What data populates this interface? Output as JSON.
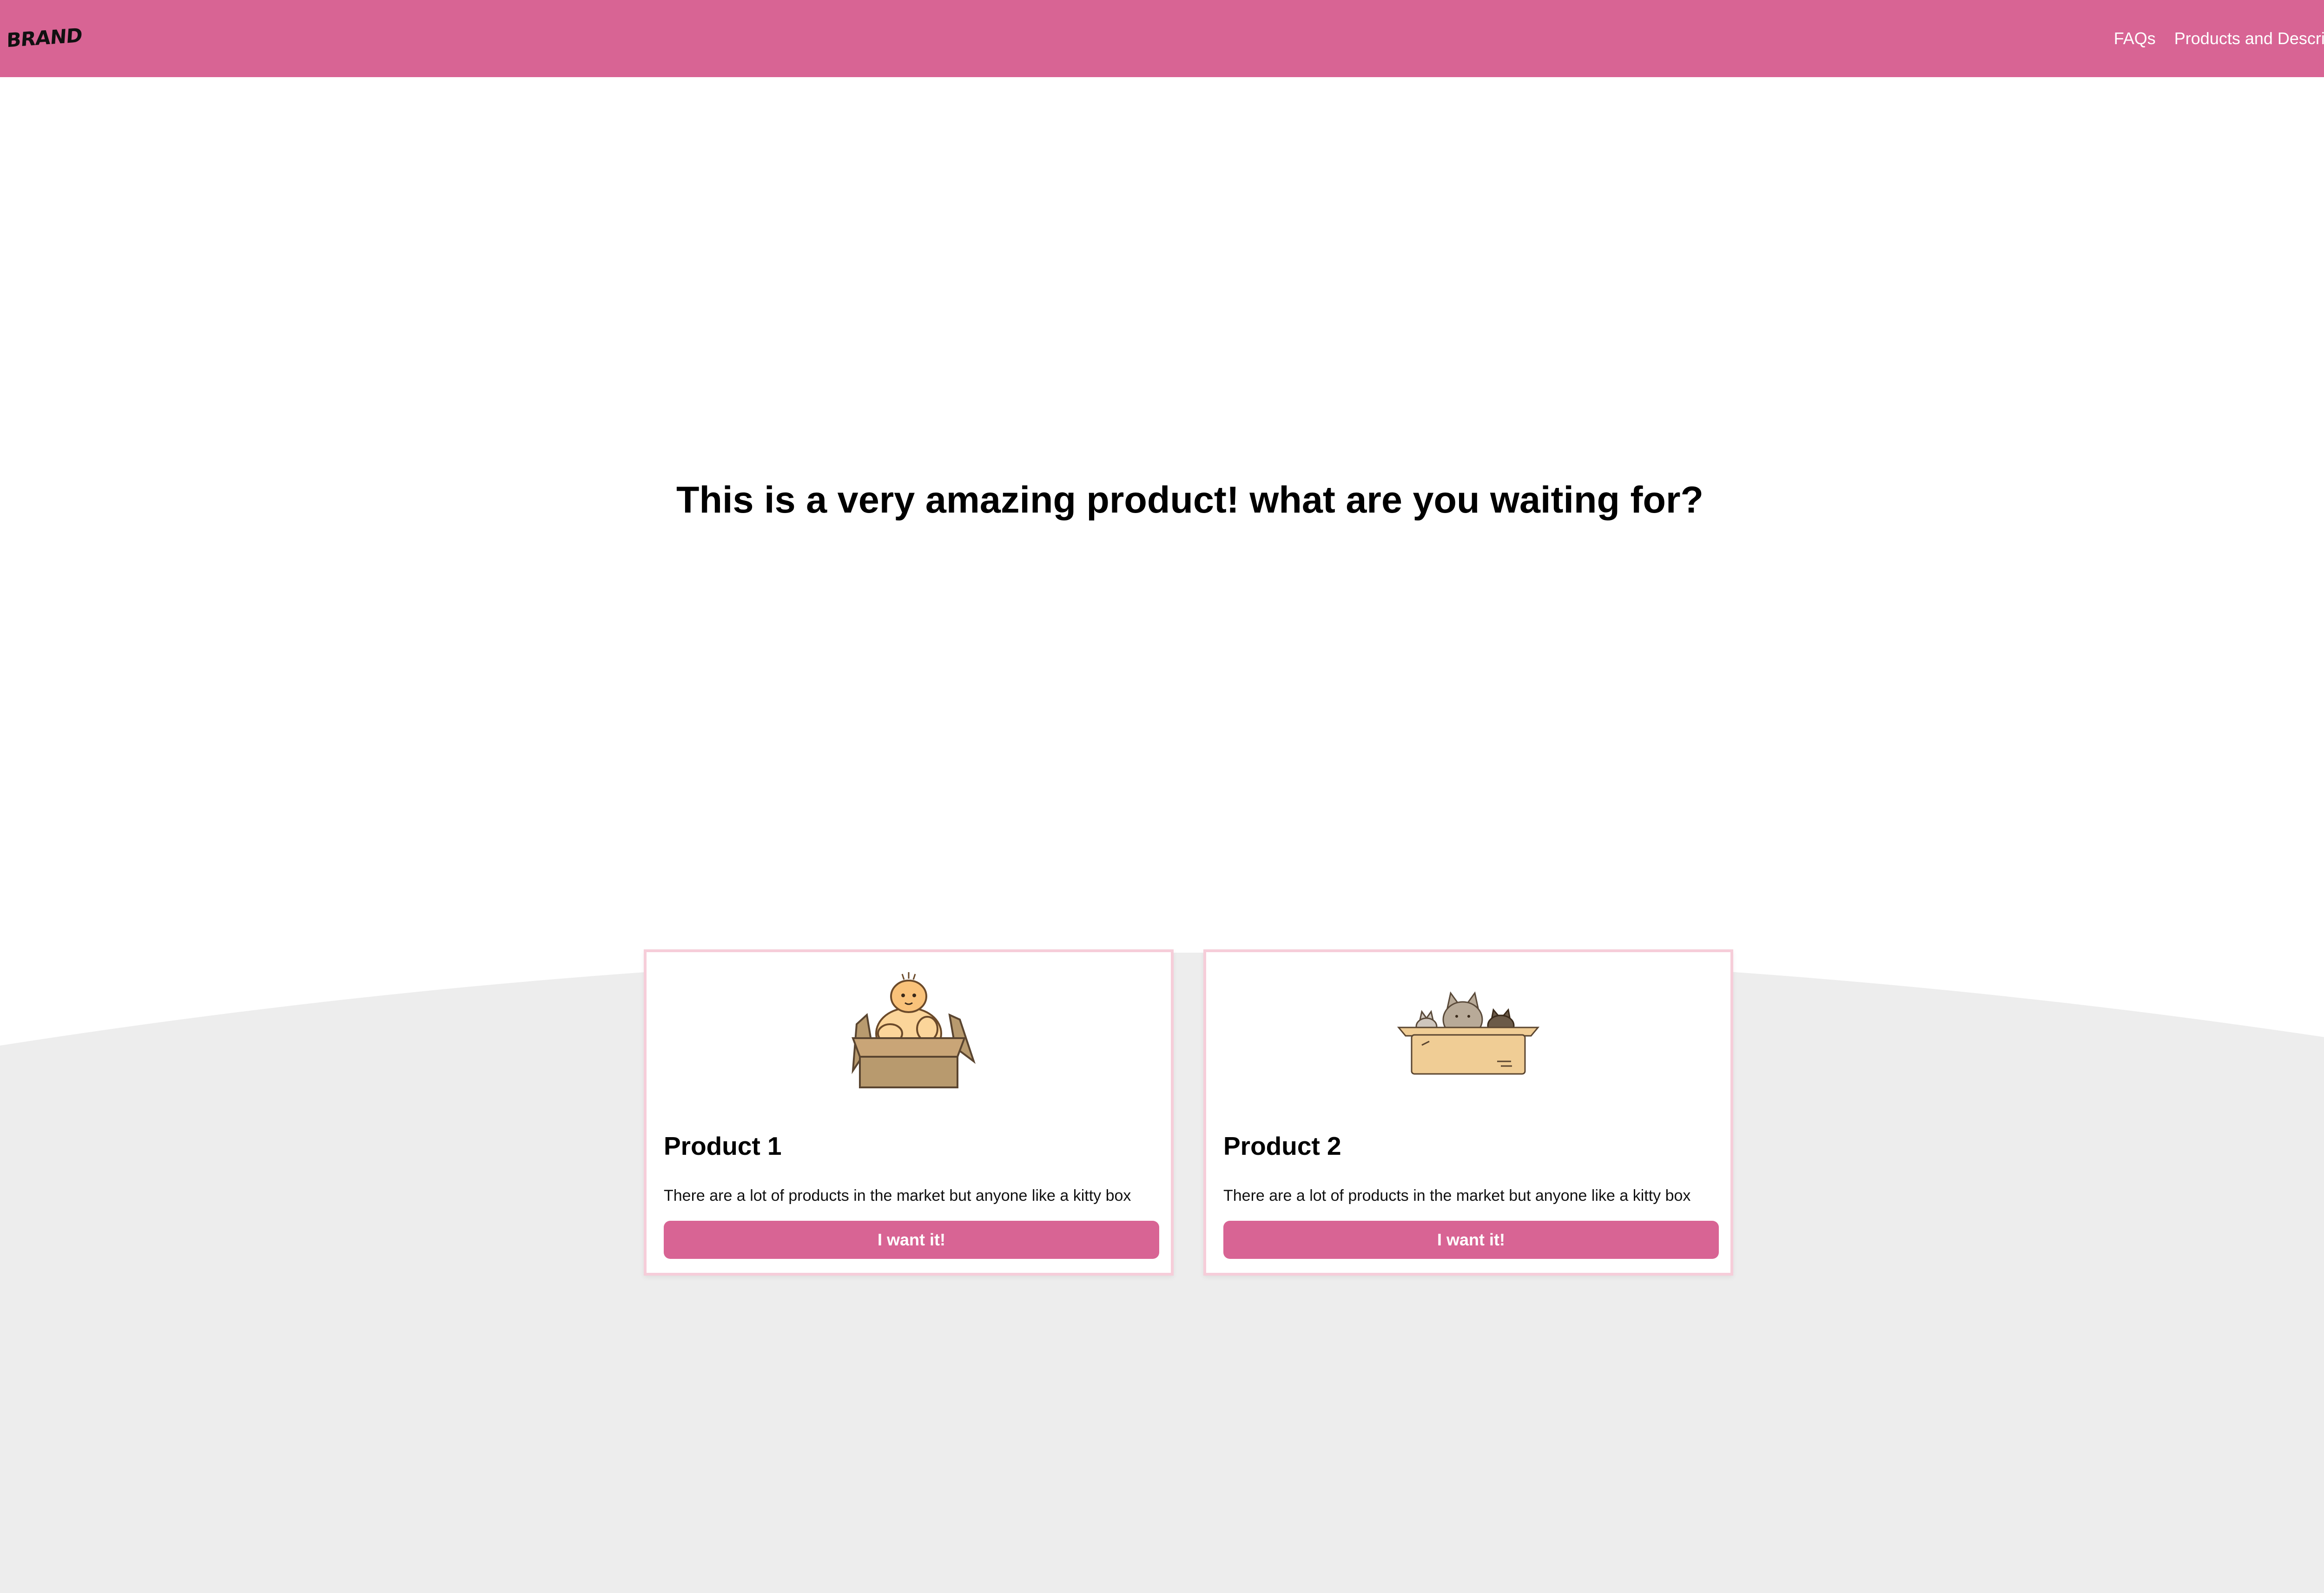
{
  "header": {
    "brand": "BRAND",
    "nav": [
      {
        "label": "FAQs"
      },
      {
        "label": "Products and Description"
      }
    ]
  },
  "hero": {
    "title": "This is a very amazing product! what are you waiting for?"
  },
  "products": [
    {
      "title": "Product 1",
      "description": "There are a lot of products in the market but anyone like a kitty box",
      "button_label": "I want it!",
      "image_icon": "cat-in-box-icon"
    },
    {
      "title": "Product 2",
      "description": "There are a lot of products in the market but anyone like a kitty box",
      "button_label": "I want it!",
      "image_icon": "cats-in-box-icon"
    }
  ],
  "colors": {
    "brand_pink": "#d86494",
    "card_border": "#f6cdd9",
    "curve_grey": "#ededed"
  }
}
